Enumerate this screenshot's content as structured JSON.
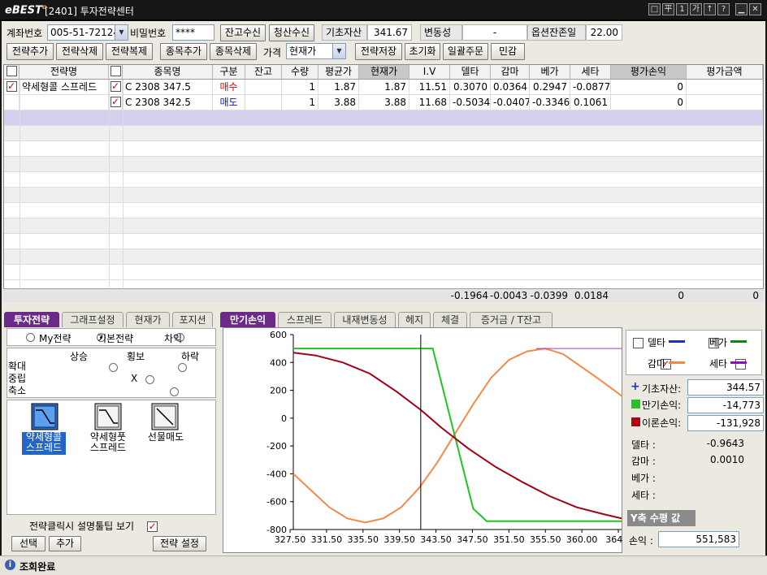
{
  "window": {
    "logo": "eBEST",
    "title": "[2401] 투자전략센터",
    "buttons": [
      "□",
      "平",
      "1",
      "가",
      "↑",
      "?"
    ]
  },
  "toolbar": {
    "account_label": "계좌번호",
    "account_value": "005-51-721245",
    "password_label": "비밀번호",
    "password_value": "****",
    "balance_btn": "잔고수신",
    "settle_btn": "청산수신",
    "base_asset_label": "기초자산",
    "base_asset_value": "341.67",
    "volatility_label": "변동성",
    "volatility_value": "-",
    "remaining_label": "옵션잔존일",
    "remaining_value": "22.00",
    "add_strategy": "전략추가",
    "del_strategy": "전략삭제",
    "copy_strategy": "전략복제",
    "add_item": "종목추가",
    "del_item": "종목삭제",
    "price_label": "가격",
    "price_value": "현재가",
    "save_strategy": "전략저장",
    "reset": "초기화",
    "bulk_order": "일괄주문",
    "sensitivity": "민감"
  },
  "grid": {
    "headers": [
      "전략명",
      "종목명",
      "구분",
      "잔고",
      "수량",
      "평균가",
      "현재가",
      "I.V",
      "델타",
      "감마",
      "베가",
      "세타",
      "평가손익",
      "평가금액"
    ],
    "rows": [
      {
        "strategy": "약세형콜 스프레드",
        "item": "C 2308 347.5",
        "side": "매수",
        "balance": "",
        "qty": "1",
        "avg": "1.87",
        "cur": "1.87",
        "iv": "11.51",
        "delta": "0.3070",
        "gamma": "0.0364",
        "vega": "0.2947",
        "theta": "-0.0877",
        "pnl": "0",
        "amount": ""
      },
      {
        "strategy": "",
        "item": "C 2308 342.5",
        "side": "매도",
        "balance": "",
        "qty": "1",
        "avg": "3.88",
        "cur": "3.88",
        "iv": "11.68",
        "delta": "-0.5034",
        "gamma": "-0.0407",
        "vega": "-0.3346",
        "theta": "0.1061",
        "pnl": "0",
        "amount": ""
      }
    ],
    "summary": {
      "delta": "-0.1964",
      "gamma": "-0.0043",
      "vega": "-0.0399",
      "theta": "0.0184",
      "pnl": "0",
      "amount": "0"
    }
  },
  "left_tabs": [
    "투자전략",
    "그래프설정",
    "현재가",
    "포지션"
  ],
  "strategy_panel": {
    "radios": [
      "My전략",
      "기본전략",
      "차익"
    ],
    "selected_radio": 1,
    "cols": [
      "상승",
      "횡보",
      "하락"
    ],
    "rows": [
      "확대",
      "중립",
      "축소"
    ],
    "x_mark": "X",
    "strategies": [
      {
        "label": "약세형콜 스프레드",
        "selected": true
      },
      {
        "label": "약세형풋 스프레드",
        "selected": false
      },
      {
        "label": "선물매도",
        "selected": false
      }
    ],
    "tooltip_label": "전략클릭시 설명툴팁 보기",
    "select_btn": "선택",
    "add_btn": "추가",
    "setting_btn": "전략 설정"
  },
  "right_tabs": [
    "만기손익",
    "스프레드",
    "내재변동성",
    "헤지",
    "체결",
    "증거금 / T잔고"
  ],
  "chart_data": {
    "type": "line",
    "x_ticks": [
      "327.50",
      "331.50",
      "335.50",
      "339.50",
      "343.50",
      "347.50",
      "351.50",
      "355.50",
      "360.00",
      "364.0"
    ],
    "y_ticks": [
      600,
      400,
      200,
      0,
      -200,
      -400,
      -600,
      -800
    ],
    "ylim": [
      -800,
      600
    ],
    "xlim": [
      327.5,
      364.0
    ],
    "cursor_x": 341.67,
    "series": [
      {
        "name": "감마",
        "color": "#f48a4a",
        "x": [
          327.5,
          329.5,
          331.5,
          333.5,
          335.5,
          337.5,
          339.5,
          341.5,
          343.5,
          345.5,
          347.5,
          349.5,
          351.5,
          353.5,
          355.5,
          357.5,
          359.5,
          361.5,
          364.0
        ],
        "y": [
          -400,
          -520,
          -640,
          -720,
          -750,
          -720,
          -640,
          -500,
          -320,
          -110,
          100,
          290,
          420,
          480,
          500,
          460,
          370,
          280,
          160
        ]
      },
      {
        "name": "만기손익",
        "color": "#22c322",
        "x": [
          327.5,
          342.5,
          343.0,
          347.5,
          349.0,
          364.0
        ],
        "y": [
          500,
          500,
          500,
          -650,
          -740,
          -740
        ]
      },
      {
        "name": "이론손익",
        "color": "#a0001a",
        "x": [
          327.5,
          330,
          333,
          336,
          339,
          341.67,
          344,
          347,
          350,
          353,
          356,
          359,
          362,
          364.0
        ],
        "y": [
          470,
          450,
          400,
          320,
          190,
          60,
          -70,
          -220,
          -350,
          -460,
          -560,
          -640,
          -690,
          -720
        ]
      },
      {
        "name": "line",
        "color": "#a03cc8",
        "x": [
          354.5,
          364.0
        ],
        "y": [
          500,
          500
        ]
      }
    ]
  },
  "legend": {
    "delta": "델타",
    "vega": "베가",
    "gamma": "감마",
    "theta": "세타",
    "delta_color": "#1c2ed6",
    "vega_color": "#0a8a0a",
    "gamma_color": "#f48a4a",
    "theta_color": "#8a10c8",
    "base_asset_label": "기초자산:",
    "base_asset_value": "344.57",
    "expiry_pnl_label": "만기손익:",
    "expiry_pnl_value": "-14,773",
    "theory_pnl_label": "이론손익:",
    "theory_pnl_value": "-131,928",
    "g_delta_label": "델타 :",
    "g_delta_value": "-0.9643",
    "g_gamma_label": "감마 :",
    "g_gamma_value": "0.0010",
    "g_vega_label": "베가 :",
    "g_vega_value": "",
    "g_theta_label": "세타 :",
    "g_theta_value": "",
    "yaxis_btn": "Y축 수평 값",
    "pnl_label": "손익 :",
    "pnl_value": "551,583"
  },
  "status": {
    "text": "조회완료"
  }
}
